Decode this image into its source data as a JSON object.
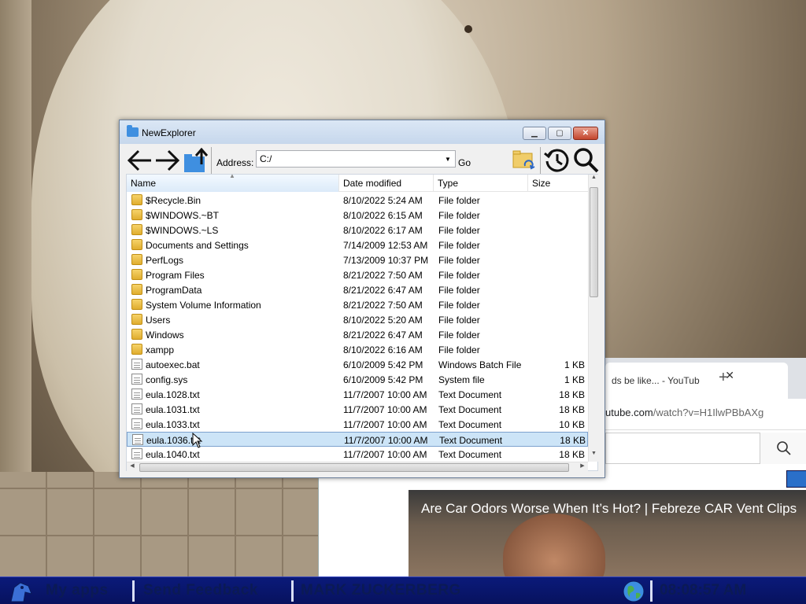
{
  "explorer": {
    "title": "NewExplorer",
    "address_label": "Address:",
    "address_value": "C:/",
    "go_label": "Go",
    "columns": {
      "name": "Name",
      "date": "Date modified",
      "type": "Type",
      "size": "Size"
    },
    "rows": [
      {
        "name": "$Recycle.Bin",
        "date": "8/10/2022 5:24 AM",
        "type": "File folder",
        "size": "",
        "icon": "folder-locked-icon"
      },
      {
        "name": "$WINDOWS.~BT",
        "date": "8/10/2022 6:15 AM",
        "type": "File folder",
        "size": "",
        "icon": "folder-icon"
      },
      {
        "name": "$WINDOWS.~LS",
        "date": "8/10/2022 6:17 AM",
        "type": "File folder",
        "size": "",
        "icon": "folder-icon"
      },
      {
        "name": "Documents and Settings",
        "date": "7/14/2009 12:53 AM",
        "type": "File folder",
        "size": "",
        "icon": "folder-locked-icon"
      },
      {
        "name": "PerfLogs",
        "date": "7/13/2009 10:37 PM",
        "type": "File folder",
        "size": "",
        "icon": "folder-icon"
      },
      {
        "name": "Program Files",
        "date": "8/21/2022 7:50 AM",
        "type": "File folder",
        "size": "",
        "icon": "folder-icon"
      },
      {
        "name": "ProgramData",
        "date": "8/21/2022 6:47 AM",
        "type": "File folder",
        "size": "",
        "icon": "folder-icon"
      },
      {
        "name": "System Volume Information",
        "date": "8/21/2022 7:50 AM",
        "type": "File folder",
        "size": "",
        "icon": "folder-locked-icon"
      },
      {
        "name": "Users",
        "date": "8/10/2022 5:20 AM",
        "type": "File folder",
        "size": "",
        "icon": "folder-icon"
      },
      {
        "name": "Windows",
        "date": "8/21/2022 6:47 AM",
        "type": "File folder",
        "size": "",
        "icon": "folder-icon"
      },
      {
        "name": "xampp",
        "date": "8/10/2022 6:16 AM",
        "type": "File folder",
        "size": "",
        "icon": "folder-icon"
      },
      {
        "name": "autoexec.bat",
        "date": "6/10/2009 5:42 PM",
        "type": "Windows Batch File",
        "size": "1 KB",
        "icon": "file-icon"
      },
      {
        "name": "config.sys",
        "date": "6/10/2009 5:42 PM",
        "type": "System file",
        "size": "1 KB",
        "icon": "file-icon"
      },
      {
        "name": "eula.1028.txt",
        "date": "11/7/2007 10:00 AM",
        "type": "Text Document",
        "size": "18 KB",
        "icon": "file-icon"
      },
      {
        "name": "eula.1031.txt",
        "date": "11/7/2007 10:00 AM",
        "type": "Text Document",
        "size": "18 KB",
        "icon": "file-icon"
      },
      {
        "name": "eula.1033.txt",
        "date": "11/7/2007 10:00 AM",
        "type": "Text Document",
        "size": "10 KB",
        "icon": "file-icon"
      },
      {
        "name": "eula.1036.txt",
        "date": "11/7/2007 10:00 AM",
        "type": "Text Document",
        "size": "18 KB",
        "icon": "file-icon",
        "selected": true
      },
      {
        "name": "eula.1040.txt",
        "date": "11/7/2007 10:00 AM",
        "type": "Text Document",
        "size": "18 KB",
        "icon": "file-icon"
      }
    ]
  },
  "browser": {
    "tab_title": "ds be like... - YouTub",
    "url_host": "utube.com",
    "url_path": "/watch?v=H1IlwPBbAXg",
    "video_title": "Are Car Odors Worse When It’s Hot? | Febreze CAR Vent Clips"
  },
  "taskbar": {
    "items": [
      "My apps",
      "Send Feedback",
      "MARK ZUCKERBERG"
    ],
    "clock": "08:08:57 AM"
  },
  "colors": {
    "selection": "#cce4f7",
    "taskbar": "#0a1a7a",
    "folder": "#e0ad2f"
  }
}
